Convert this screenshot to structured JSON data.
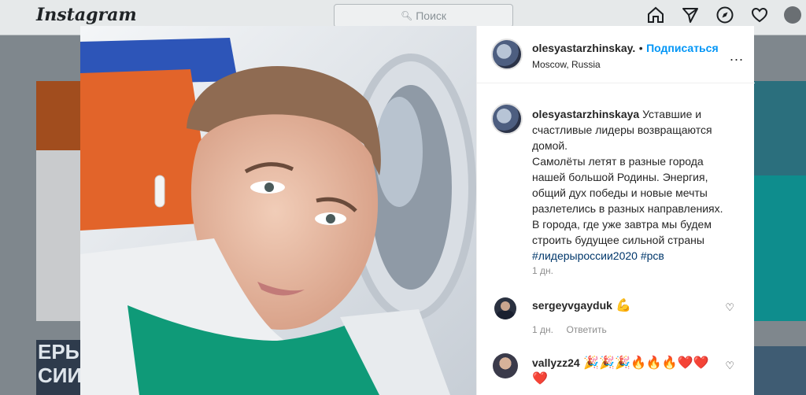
{
  "topbar": {
    "logo": "Instagram",
    "search_placeholder": "Поиск",
    "icons": [
      "home-icon",
      "direct-icon",
      "explore-icon",
      "heart-icon",
      "profile-avatar"
    ]
  },
  "background": {
    "left_text": "ЕРЫ\nСИИ"
  },
  "post": {
    "author": "olesyastarzhinskay.",
    "separator": "•",
    "follow_label": "Подписаться",
    "location": "Moscow, Russia",
    "more_label": "...",
    "caption": {
      "author": "olesyastarzhinskaya",
      "lines": [
        "Уставшие и",
        "счастливые лидеры возвращаются",
        "домой.",
        "Самолёты летят в разные города",
        "нашей большой Родины. Энергия,",
        "общий дух победы и новые мечты",
        "разлетелись в разных направлениях.",
        "В города, где уже завтра мы будем",
        "строить будущее сильной страны",
        "#лидерыроссии2020 #рсв"
      ],
      "time": "1 дн."
    },
    "comments": [
      {
        "user": "sergeyvgayduk",
        "emoji": "💪",
        "time": "1 дн.",
        "reply": "Ответить"
      },
      {
        "user": "vallyzz24",
        "emoji": "🎉🎉🎉🔥🔥🔥❤️❤️",
        "emoji2": "❤️"
      }
    ]
  },
  "colors": {
    "accent": "#0095f6",
    "text": "#262626",
    "muted": "#8e8e8e"
  }
}
